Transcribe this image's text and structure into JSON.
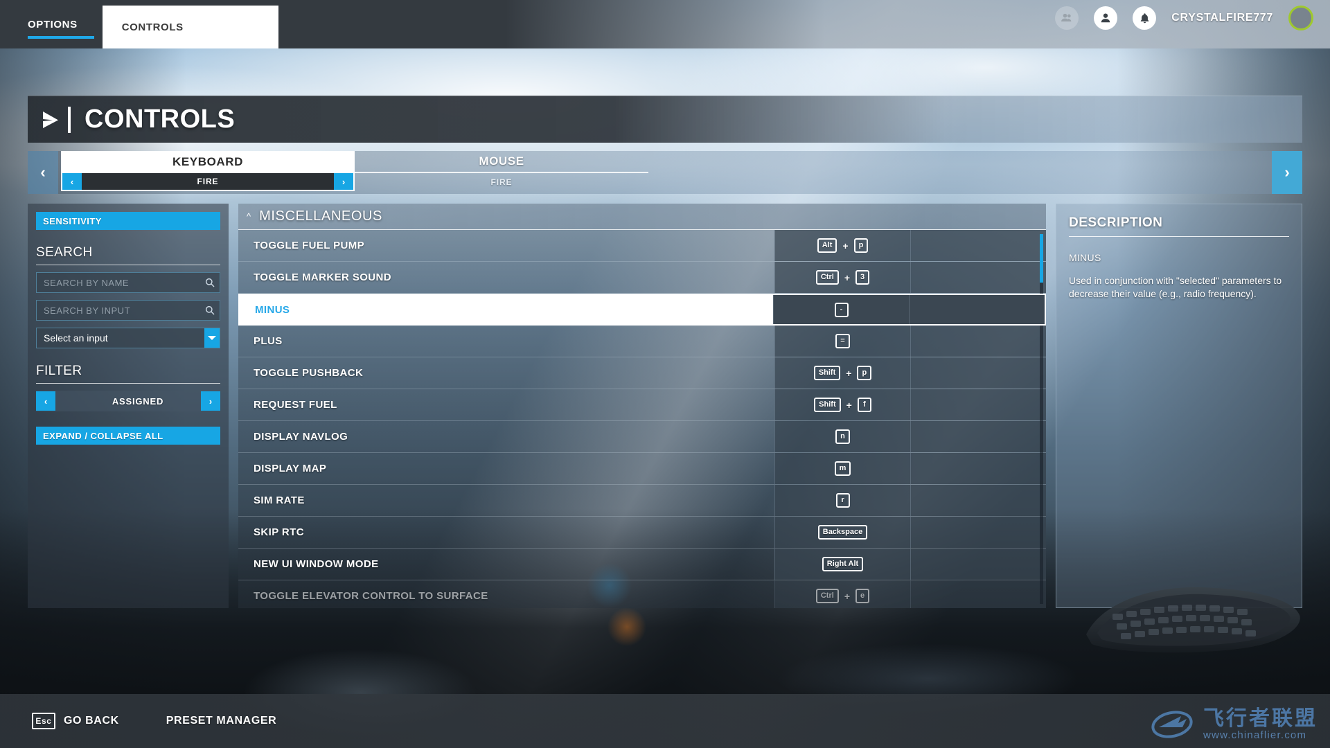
{
  "topbar": {
    "tabs": [
      {
        "label": "OPTIONS",
        "active": false
      },
      {
        "label": "CONTROLS",
        "active": true
      }
    ],
    "icons": [
      "friends-icon",
      "profile-icon",
      "notifications-icon"
    ],
    "username": "CRYSTALFIRE777",
    "avatar_ring_color": "#9fc92e"
  },
  "header": {
    "title": "CONTROLS",
    "chevron_icon": "chevron-right-icon"
  },
  "device_selector": {
    "left_arrow": "‹",
    "right_arrow": "›",
    "devices": [
      {
        "name": "KEYBOARD",
        "preset": "FIRE",
        "selected": true
      },
      {
        "name": "MOUSE",
        "preset": "FIRE",
        "selected": false
      }
    ]
  },
  "sidebar": {
    "sensitivity_label": "SENSITIVITY",
    "search_title": "SEARCH",
    "search_by_name_placeholder": "SEARCH BY NAME",
    "search_by_name_value": "",
    "search_by_input_placeholder": "SEARCH BY INPUT",
    "search_by_input_value": "",
    "select_input_value": "Select an input",
    "filter_title": "FILTER",
    "filter_value": "ASSIGNED",
    "expand_collapse_label": "EXPAND / COLLAPSE ALL"
  },
  "bindings": {
    "group_label": "MISCELLANEOUS",
    "group_expanded": true,
    "rows": [
      {
        "name": "TOGGLE FUEL PUMP",
        "keys": [
          "Alt",
          "p"
        ],
        "secondary": ""
      },
      {
        "name": "TOGGLE MARKER SOUND",
        "keys": [
          "Ctrl",
          "3"
        ],
        "secondary": ""
      },
      {
        "name": "MINUS",
        "keys": [
          "-"
        ],
        "secondary": "",
        "selected": true
      },
      {
        "name": "PLUS",
        "keys": [
          "="
        ],
        "secondary": ""
      },
      {
        "name": "TOGGLE PUSHBACK",
        "keys": [
          "Shift",
          "p"
        ],
        "secondary": ""
      },
      {
        "name": "REQUEST FUEL",
        "keys": [
          "Shift",
          "f"
        ],
        "secondary": ""
      },
      {
        "name": "DISPLAY NAVLOG",
        "keys": [
          "n"
        ],
        "secondary": ""
      },
      {
        "name": "DISPLAY MAP",
        "keys": [
          "m"
        ],
        "secondary": ""
      },
      {
        "name": "SIM RATE",
        "keys": [
          "r"
        ],
        "secondary": ""
      },
      {
        "name": "SKIP RTC",
        "keys": [
          "Backspace"
        ],
        "secondary": ""
      },
      {
        "name": "NEW UI WINDOW MODE",
        "keys": [
          "Right Alt"
        ],
        "secondary": ""
      },
      {
        "name": "TOGGLE ELEVATOR CONTROL TO SURFACE",
        "keys": [
          "Ctrl",
          "e"
        ],
        "secondary": "",
        "clipped": true
      }
    ]
  },
  "description": {
    "title": "DESCRIPTION",
    "name": "MINUS",
    "text": "Used in conjunction with \"selected\" parameters to decrease their value (e.g., radio frequency)."
  },
  "bottombar": {
    "back_key": "Esc",
    "back_label": "GO BACK",
    "preset_manager_label": "PRESET MANAGER"
  },
  "watermark": {
    "cn": "飞行者联盟",
    "url": "www.chinaflier.com"
  }
}
